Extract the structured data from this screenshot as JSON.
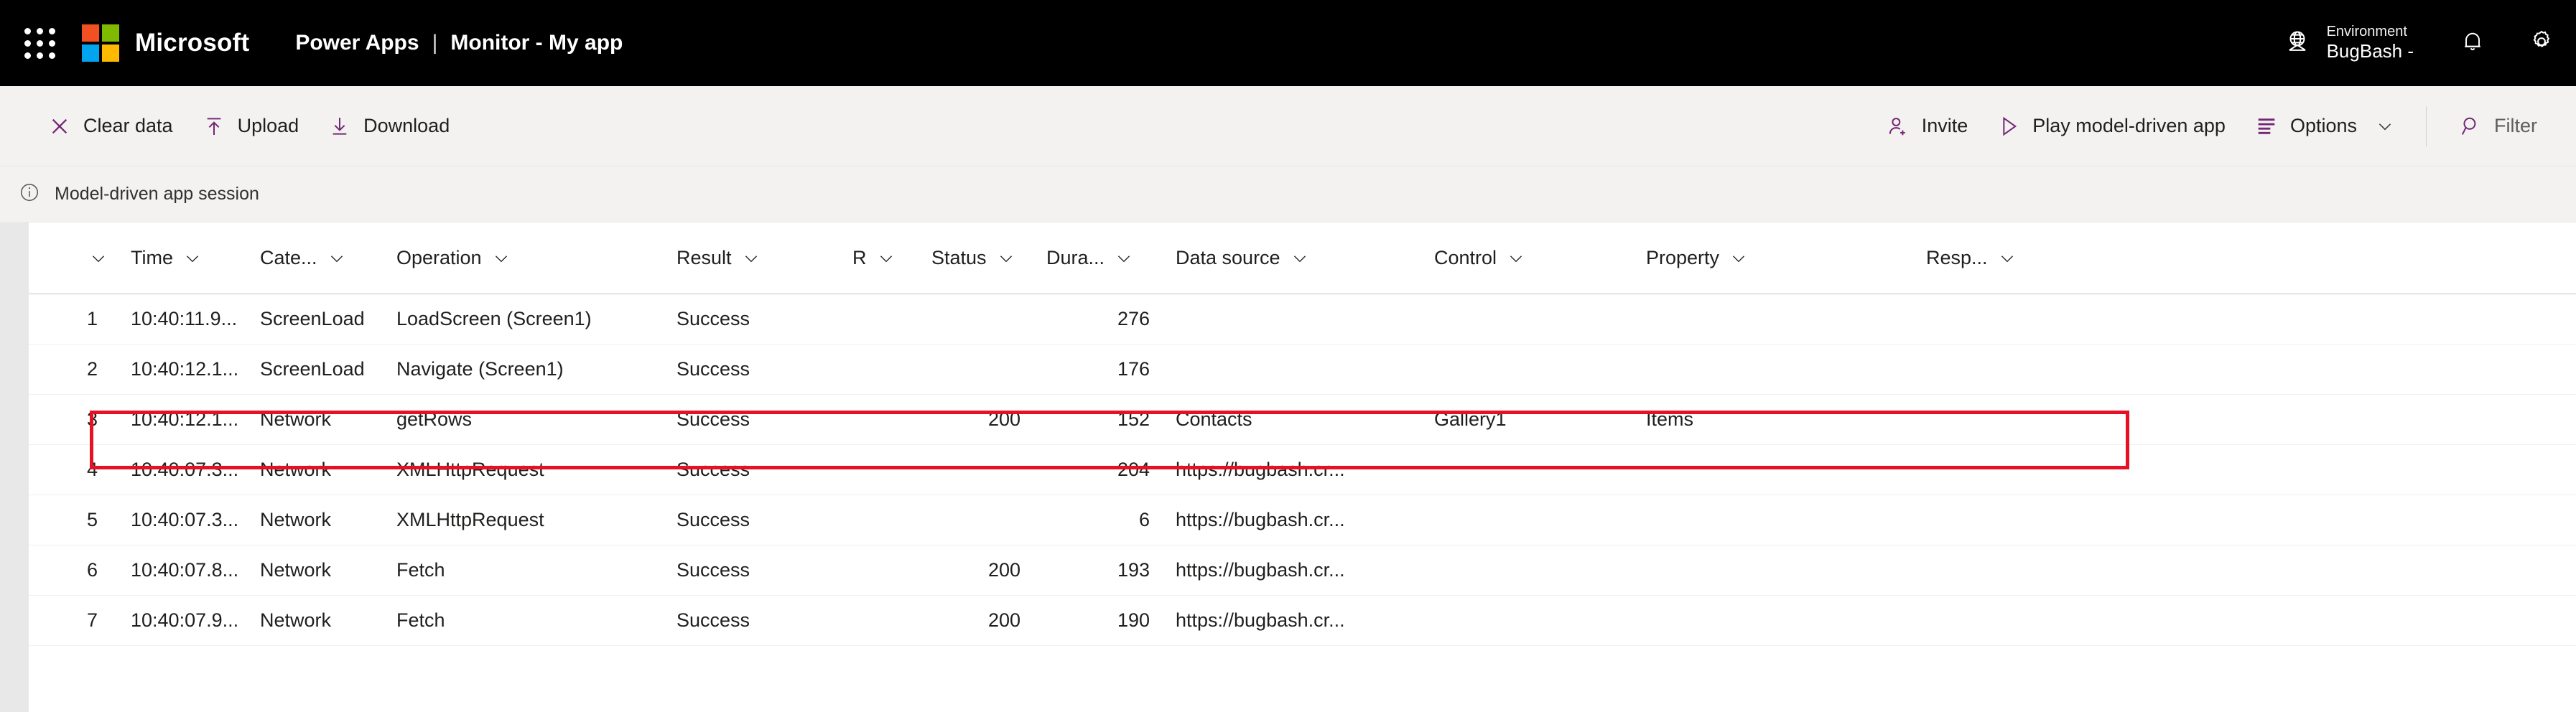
{
  "header": {
    "waffle_icon": "app-launcher-icon",
    "brand": "Microsoft",
    "product": "Power Apps",
    "divider": "|",
    "page_title": "Monitor - My app",
    "environment": {
      "icon": "globe-icon",
      "label": "Environment",
      "value": "BugBash -"
    },
    "notifications_icon": "bell-icon",
    "settings_icon": "gear-icon"
  },
  "command_bar": {
    "left": [
      {
        "label": "Clear data",
        "icon": "close-x-icon"
      },
      {
        "label": "Upload",
        "icon": "upload-arrow-icon"
      },
      {
        "label": "Download",
        "icon": "download-arrow-icon"
      }
    ],
    "right": [
      {
        "label": "Invite",
        "icon": "add-person-icon"
      },
      {
        "label": "Play model-driven app",
        "icon": "play-triangle-icon"
      },
      {
        "label": "Options",
        "icon": "options-lines-icon",
        "has_chevron": true
      },
      {
        "label": "Filter",
        "icon": "search-magnifier-icon"
      }
    ]
  },
  "session_bar": {
    "icon": "info-circle-icon",
    "text": "Model-driven app session"
  },
  "table": {
    "columns": [
      {
        "key": "index",
        "label": "",
        "sortable": true
      },
      {
        "key": "time",
        "label": "Time",
        "sortable": true
      },
      {
        "key": "category",
        "label": "Cate...",
        "sortable": true
      },
      {
        "key": "operation",
        "label": "Operation",
        "sortable": true
      },
      {
        "key": "result",
        "label": "Result",
        "sortable": true
      },
      {
        "key": "request",
        "label": "R",
        "sortable": true
      },
      {
        "key": "status",
        "label": "Status",
        "sortable": true
      },
      {
        "key": "duration",
        "label": "Dura...",
        "sortable": true
      },
      {
        "key": "datasource",
        "label": "Data source",
        "sortable": true
      },
      {
        "key": "control",
        "label": "Control",
        "sortable": true
      },
      {
        "key": "property",
        "label": "Property",
        "sortable": true
      },
      {
        "key": "response",
        "label": "Resp...",
        "sortable": true
      }
    ],
    "rows": [
      {
        "index": "1",
        "time": "10:40:11.9...",
        "category": "ScreenLoad",
        "operation": "LoadScreen (Screen1)",
        "result": "Success",
        "request": "",
        "status": "",
        "duration": "276",
        "datasource": "",
        "control": "",
        "property": "",
        "response": "",
        "highlighted": false
      },
      {
        "index": "2",
        "time": "10:40:12.1...",
        "category": "ScreenLoad",
        "operation": "Navigate (Screen1)",
        "result": "Success",
        "request": "",
        "status": "",
        "duration": "176",
        "datasource": "",
        "control": "",
        "property": "",
        "response": "",
        "highlighted": false
      },
      {
        "index": "3",
        "time": "10:40:12.1...",
        "category": "Network",
        "operation": "getRows",
        "result": "Success",
        "request": "",
        "status": "200",
        "duration": "152",
        "datasource": "Contacts",
        "control": "Gallery1",
        "property": "Items",
        "response": "",
        "highlighted": true
      },
      {
        "index": "4",
        "time": "10:40:07.3...",
        "category": "Network",
        "operation": "XMLHttpRequest",
        "result": "Success",
        "request": "",
        "status": "",
        "duration": "204",
        "datasource": "https://bugbash.cr...",
        "control": "",
        "property": "",
        "response": "",
        "highlighted": false
      },
      {
        "index": "5",
        "time": "10:40:07.3...",
        "category": "Network",
        "operation": "XMLHttpRequest",
        "result": "Success",
        "request": "",
        "status": "",
        "duration": "6",
        "datasource": "https://bugbash.cr...",
        "control": "",
        "property": "",
        "response": "",
        "highlighted": false
      },
      {
        "index": "6",
        "time": "10:40:07.8...",
        "category": "Network",
        "operation": "Fetch",
        "result": "Success",
        "request": "",
        "status": "200",
        "duration": "193",
        "datasource": "https://bugbash.cr...",
        "control": "",
        "property": "",
        "response": "",
        "highlighted": false
      },
      {
        "index": "7",
        "time": "10:40:07.9...",
        "category": "Network",
        "operation": "Fetch",
        "result": "Success",
        "request": "",
        "status": "200",
        "duration": "190",
        "datasource": "https://bugbash.cr...",
        "control": "",
        "property": "",
        "response": "",
        "highlighted": false
      }
    ]
  },
  "colors": {
    "header_bg": "#000000",
    "accent_purple": "#742774",
    "highlight_red": "#e81123",
    "command_bar_bg": "#f4f2f1"
  }
}
